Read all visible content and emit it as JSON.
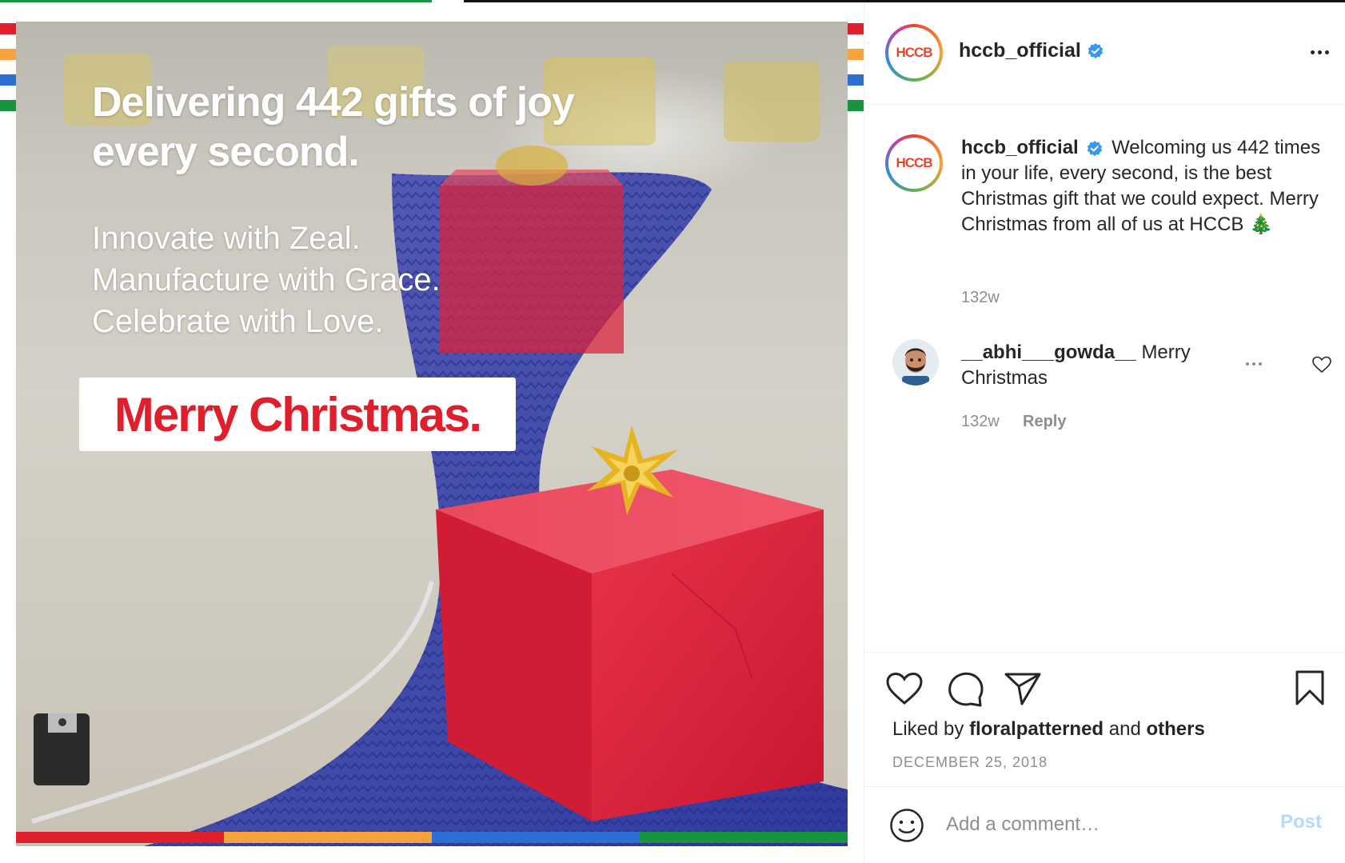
{
  "brand_colors": [
    "#e01f2d",
    "#f7a23b",
    "#2a6fd1",
    "#17943f"
  ],
  "post_image": {
    "headline": "Delivering 442 gifts of joy every second.",
    "tagline_lines": [
      "Innovate with Zeal.",
      "Manufacture with Grace.",
      "Celebrate with Love."
    ],
    "greeting": "Merry Christmas."
  },
  "header": {
    "avatar_logo": "HCCB",
    "username": "hccb_official",
    "verified_icon": "verified-badge-icon",
    "more_icon": "more-options-icon"
  },
  "caption": {
    "username": "hccb_official",
    "text": "Welcoming us 442 times in your life, every second, is the best Christmas gift that we could expect. Merry Christmas from all of us at HCCB 🎄",
    "time": "132w"
  },
  "comment": {
    "username": "__abhi___gowda__",
    "text": "Merry Christmas",
    "time": "132w",
    "reply_label": "Reply"
  },
  "actions": {
    "like_icon": "heart-icon",
    "comment_icon": "comment-icon",
    "share_icon": "send-icon",
    "save_icon": "bookmark-icon"
  },
  "likes": {
    "prefix": "Liked by",
    "user": "floralpatterned",
    "joiner": "and",
    "others": "others"
  },
  "date": "DECEMBER 25, 2018",
  "add_comment": {
    "placeholder": "Add a comment…",
    "post_label": "Post"
  }
}
